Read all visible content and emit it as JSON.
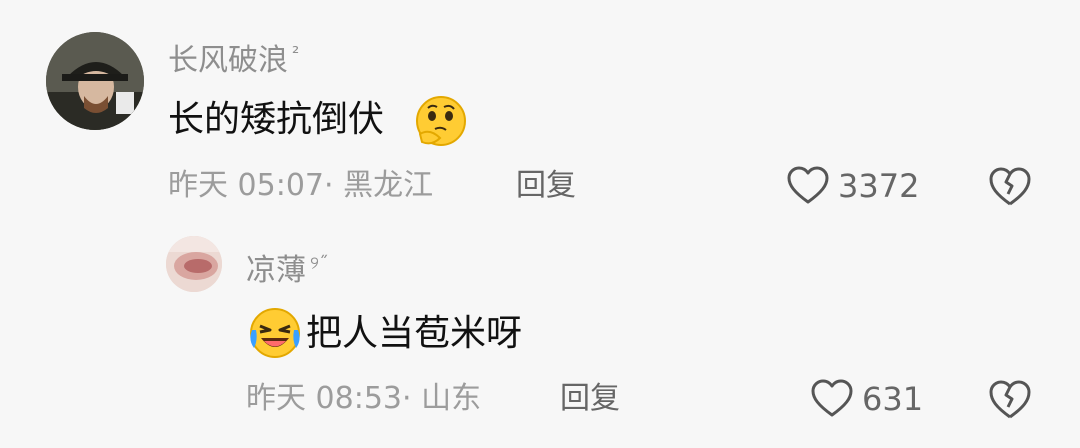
{
  "comment": {
    "username": "长风破浪",
    "username_badge": "²",
    "text": "长的矮抗倒伏",
    "meta": "昨天 05:07· 黑龙江",
    "reply_label": "回复",
    "likes": "3372",
    "emoji_name": "thinking-face-emoji",
    "reply": {
      "username": "凉薄",
      "username_badge": "୨˝",
      "text": "把人当苞米呀",
      "meta": "昨天 08:53· 山东",
      "reply_label": "回复",
      "likes": "631",
      "emoji_name": "crying-laughing-face-emoji"
    }
  },
  "colors": {
    "background": "#f7f7f7",
    "username": "#8e8e8e",
    "text": "#111111",
    "meta": "#9c9c9c",
    "action": "#666666"
  }
}
